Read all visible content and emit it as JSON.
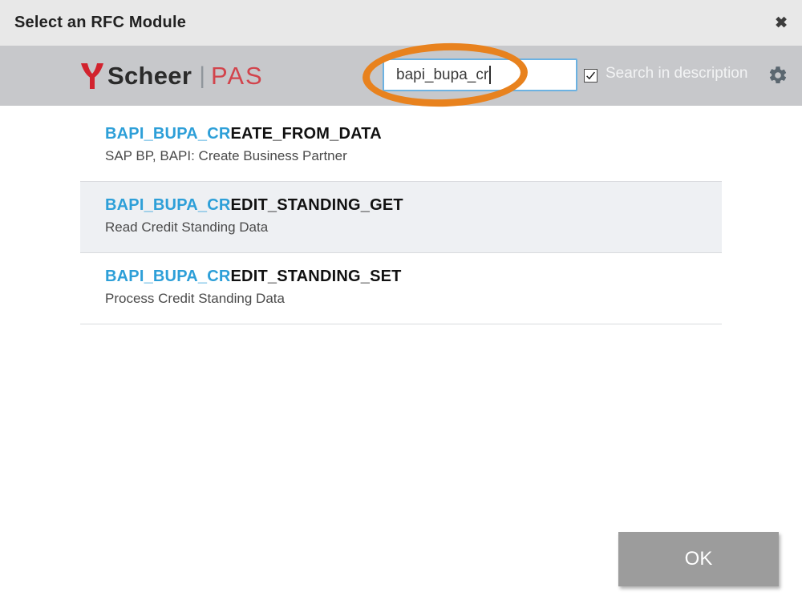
{
  "dialog": {
    "title": "Select an RFC Module"
  },
  "icons": {
    "close": "close-icon: ✕ glyph",
    "gear": "gear-icon: settings cog",
    "checkmark": "check-icon: ✓ inside checkbox",
    "logo_mark": "scheer-y-mark: red stylized Y"
  },
  "toolbar": {
    "logo": {
      "name": "Scheer",
      "pipe": "|",
      "suffix": "PAS"
    },
    "search": {
      "value": "bapi_bupa_cr"
    },
    "checkbox": {
      "checked": true,
      "label": "Search in description"
    }
  },
  "annotation": {
    "shape": "hand-drawn orange ellipse around search input",
    "color": "#e8821e"
  },
  "list": {
    "items": [
      {
        "match": "BAPI_BUPA_CR",
        "rest": "EATE_FROM_DATA",
        "description": "SAP BP, BAPI: Create Business Partner",
        "highlighted": false
      },
      {
        "match": "BAPI_BUPA_CR",
        "rest": "EDIT_STANDING_GET",
        "description": "Read Credit Standing Data",
        "highlighted": true
      },
      {
        "match": "BAPI_BUPA_CR",
        "rest": "EDIT_STANDING_SET",
        "description": "Process Credit Standing Data",
        "highlighted": false
      }
    ]
  },
  "footer": {
    "ok_label": "OK"
  },
  "colors": {
    "titlebar_bg": "#e8e8e8",
    "toolbar_bg": "#c7c8cb",
    "accent_blue": "#2d9fd8",
    "brand_red": "#d2232e",
    "brand_red_light": "#d2444c",
    "highlight_row_bg": "#eef0f3",
    "input_border_blue": "#6cb2e2",
    "annotation_orange": "#e8821e",
    "ok_button_bg": "#9c9c9c"
  }
}
